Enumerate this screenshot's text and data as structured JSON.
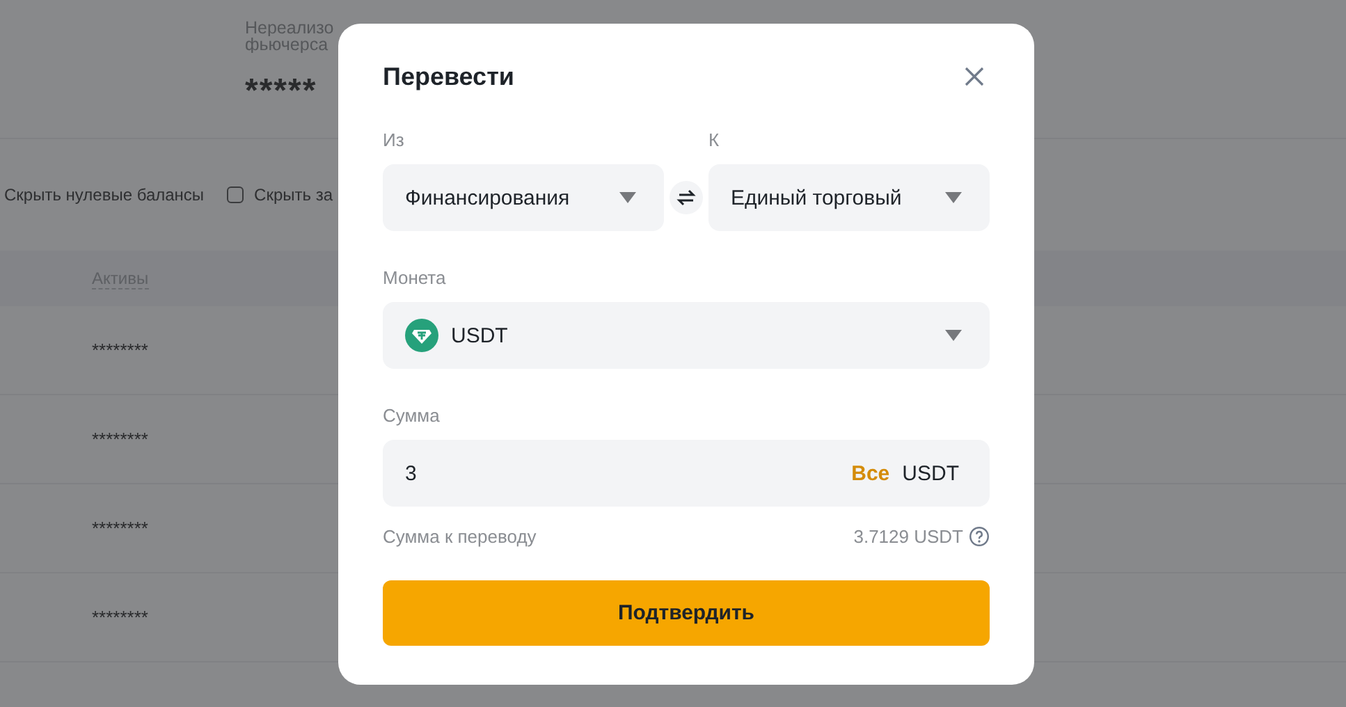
{
  "background": {
    "summary": {
      "label_lines": [
        "Нереализо",
        "фьючерса"
      ],
      "value": "*****"
    },
    "filters": [
      {
        "kind": "text",
        "label": "Скрыть нулевые балансы"
      },
      {
        "kind": "checkbox",
        "label": "Скрыть за",
        "checked": false
      }
    ],
    "table": {
      "columns": [
        "Активы"
      ],
      "rows": [
        {
          "asset": "********"
        },
        {
          "asset": "********"
        },
        {
          "asset": "********"
        },
        {
          "asset": "********"
        }
      ]
    }
  },
  "dialog": {
    "title": "Перевести",
    "from": {
      "label": "Из",
      "value": "Финансирования"
    },
    "to": {
      "label": "К",
      "value": "Единый торговый"
    },
    "coin": {
      "label": "Монета",
      "value": "USDT"
    },
    "amount": {
      "label": "Сумма",
      "value": "3",
      "max_link": "Все",
      "unit": "USDT"
    },
    "receive": {
      "label": "Сумма к переводу",
      "value": "3.7129 USDT"
    },
    "confirm_button": "Подтвердить"
  }
}
